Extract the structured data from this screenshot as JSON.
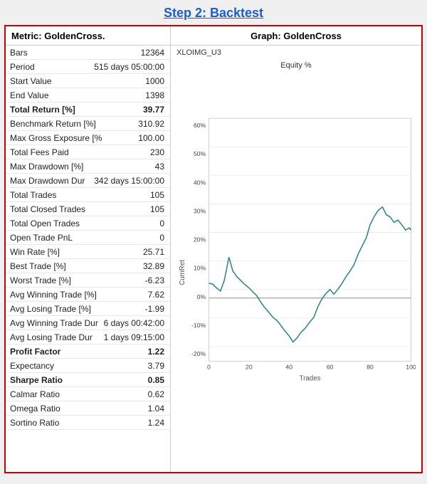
{
  "header": {
    "title": "Step 2:  Backtest"
  },
  "left_panel": {
    "title": "Metric:  GoldenCross.",
    "rows": [
      {
        "label": "Bars",
        "value": "12364",
        "bold": false
      },
      {
        "label": "Period",
        "value": "515 days 05:00:00",
        "bold": false
      },
      {
        "label": "Start Value",
        "value": "1000",
        "bold": false
      },
      {
        "label": "End Value",
        "value": "1398",
        "bold": false
      },
      {
        "label": "Total Return [%]",
        "value": "39.77",
        "bold": true
      },
      {
        "label": "Benchmark Return [%]",
        "value": "310.92",
        "bold": false
      },
      {
        "label": "Max Gross Exposure [%",
        "value": "100.00",
        "bold": false
      },
      {
        "label": "Total Fees Paid",
        "value": "230",
        "bold": false
      },
      {
        "label": "Max Drawdown [%]",
        "value": "43",
        "bold": false
      },
      {
        "label": "Max Drawdown Dur",
        "value": "342 days 15:00:00",
        "bold": false
      },
      {
        "label": "Total Trades",
        "value": "105",
        "bold": false
      },
      {
        "label": "Total Closed Trades",
        "value": "105",
        "bold": false
      },
      {
        "label": "Total Open Trades",
        "value": "0",
        "bold": false
      },
      {
        "label": "Open Trade PnL",
        "value": "0",
        "bold": false
      },
      {
        "label": "Win Rate [%]",
        "value": "25.71",
        "bold": false
      },
      {
        "label": "Best Trade [%]",
        "value": "32.89",
        "bold": false
      },
      {
        "label": "Worst Trade [%]",
        "value": "-6.23",
        "bold": false
      },
      {
        "label": "Avg Winning Trade [%]",
        "value": "7.62",
        "bold": false
      },
      {
        "label": "Avg Losing Trade [%]",
        "value": "-1.99",
        "bold": false
      },
      {
        "label": "Avg Winning Trade Dur",
        "value": "6 days 00:42:00",
        "bold": false
      },
      {
        "label": "Avg Losing Trade Dur",
        "value": "1 days 09:15:00",
        "bold": false
      },
      {
        "label": "Profit Factor",
        "value": "1.22",
        "bold": true
      },
      {
        "label": "Expectancy",
        "value": "3.79",
        "bold": false
      },
      {
        "label": "Sharpe Ratio",
        "value": "0.85",
        "bold": true
      },
      {
        "label": "Calmar Ratio",
        "value": "0.62",
        "bold": false
      },
      {
        "label": "Omega Ratio",
        "value": "1.04",
        "bold": false
      },
      {
        "label": "Sortino Ratio",
        "value": "1.24",
        "bold": false
      }
    ]
  },
  "right_panel": {
    "title": "Graph:  GoldenCross",
    "graph_label": "XLOIMG_U3",
    "chart_title": "Equity %",
    "x_axis_label": "Trades",
    "y_axis_label": "CumRet",
    "y_ticks": [
      "60%",
      "50%",
      "40%",
      "30%",
      "20%",
      "10%",
      "0%",
      "-10%",
      "-20%"
    ],
    "x_ticks": [
      "0",
      "20",
      "40",
      "60",
      "80",
      "100"
    ]
  }
}
